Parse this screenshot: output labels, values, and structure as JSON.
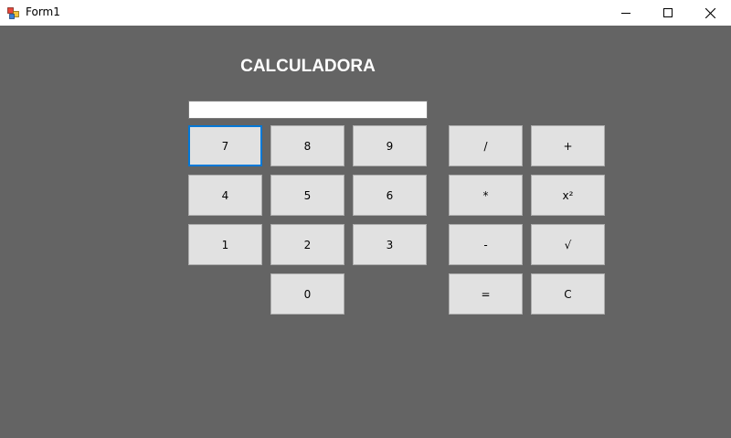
{
  "window": {
    "title": "Form1",
    "icon": "winforms-app-icon",
    "controls": [
      "minimize-icon",
      "maximize-icon",
      "close-icon"
    ]
  },
  "heading": "CALCULADORA",
  "display": {
    "value": "",
    "placeholder": ""
  },
  "buttons": {
    "seven": "7",
    "eight": "8",
    "nine": "9",
    "four": "4",
    "five": "5",
    "six": "6",
    "one": "1",
    "two": "2",
    "three": "3",
    "zero": "0",
    "divide": "/",
    "plus": "+",
    "multiply": "*",
    "square": "x²",
    "minus": "-",
    "sqrt": "√",
    "equals": "=",
    "clear": "C"
  },
  "colors": {
    "background": "#646464",
    "button": "#e1e1e1",
    "focus": "#0078d7"
  }
}
